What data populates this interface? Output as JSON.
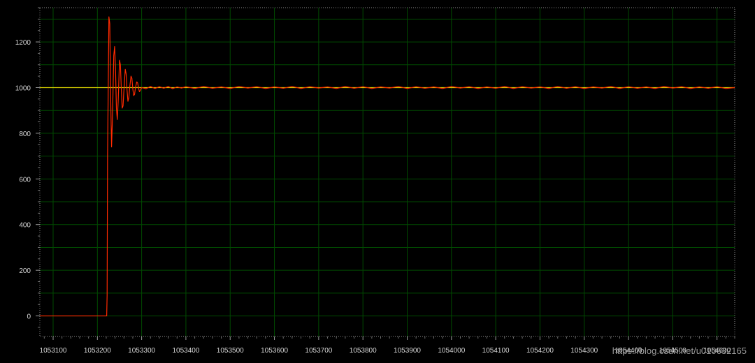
{
  "watermark": "https://blog.csdn.net/u010632165",
  "chart_data": {
    "type": "line",
    "title": "",
    "xlabel": "",
    "ylabel": "",
    "xlim": [
      1053070,
      1054640
    ],
    "ylim": [
      -90,
      1350
    ],
    "grid": true,
    "x_ticks": [
      1053100,
      1053200,
      1053300,
      1053400,
      1053500,
      1053600,
      1053700,
      1053800,
      1053900,
      1054000,
      1054100,
      1054200,
      1054300,
      1054400,
      1054500,
      1054600
    ],
    "x_tick_labels": [
      "1053100",
      "1053200",
      "1053300",
      "1053400",
      "1053500",
      "1053600",
      "1053700",
      "1053800",
      "1053900",
      "1054000",
      "1054100",
      "1054200",
      "1054300",
      "1054400",
      "1054500",
      "1054600"
    ],
    "y_ticks": [
      0,
      200,
      400,
      600,
      800,
      1000,
      1200
    ],
    "y_tick_labels": [
      "0",
      "200",
      "400",
      "600",
      "800",
      "1000",
      "1200"
    ],
    "series": [
      {
        "color": "#d8d000",
        "x": [
          1053070,
          1054640
        ],
        "y": [
          1000,
          1000
        ]
      },
      {
        "color": "#ff2a00",
        "x": [
          1053070,
          1053221,
          1053222,
          1053223,
          1053225,
          1053226,
          1053228,
          1053230,
          1053232,
          1053234,
          1053237,
          1053239,
          1053241,
          1053243,
          1053245,
          1053247,
          1053250,
          1053252,
          1053254,
          1053256,
          1053258,
          1053260,
          1053263,
          1053265,
          1053267,
          1053269,
          1053271,
          1053273,
          1053276,
          1053278,
          1053280,
          1053282,
          1053284,
          1053286,
          1053289,
          1053291,
          1053293,
          1053295,
          1053297,
          1053300,
          1053310,
          1053320,
          1053330,
          1053340,
          1053350,
          1053360,
          1053370,
          1053380,
          1053390,
          1053400,
          1053420,
          1053440,
          1053460,
          1053480,
          1053500,
          1053520,
          1053540,
          1053560,
          1053580,
          1053600,
          1053620,
          1053640,
          1053660,
          1053680,
          1053700,
          1053720,
          1053740,
          1053760,
          1053780,
          1053800,
          1053820,
          1053840,
          1053860,
          1053880,
          1053900,
          1053920,
          1053940,
          1053960,
          1053980,
          1054000,
          1054020,
          1054040,
          1054060,
          1054080,
          1054100,
          1054120,
          1054140,
          1054160,
          1054180,
          1054200,
          1054220,
          1054240,
          1054260,
          1054280,
          1054300,
          1054320,
          1054340,
          1054360,
          1054380,
          1054400,
          1054420,
          1054440,
          1054460,
          1054480,
          1054500,
          1054520,
          1054540,
          1054560,
          1054580,
          1054600,
          1054620,
          1054640
        ],
        "y": [
          0,
          0,
          90,
          700,
          1100,
          1310,
          1280,
          960,
          740,
          860,
          1140,
          1180,
          1080,
          910,
          860,
          940,
          1120,
          1100,
          1000,
          910,
          920,
          990,
          1080,
          1060,
          990,
          940,
          955,
          1000,
          1050,
          1040,
          995,
          965,
          970,
          1000,
          1025,
          1020,
          998,
          982,
          988,
          1000,
          995,
          1005,
          996,
          1004,
          997,
          1005,
          995,
          1003,
          998,
          1004,
          996,
          1005,
          997,
          1003,
          996,
          1005,
          998,
          1004,
          996,
          1003,
          997,
          1005,
          996,
          1004,
          998,
          1003,
          996,
          1005,
          997,
          1004,
          996,
          1003,
          998,
          1005,
          996,
          1004,
          997,
          1003,
          996,
          1005,
          998,
          1004,
          996,
          1003,
          997,
          1005,
          996,
          1004,
          998,
          1003,
          996,
          1005,
          997,
          1004,
          996,
          1003,
          998,
          1005,
          996,
          1004,
          997,
          1003,
          996,
          1005,
          998,
          1004,
          996,
          1003,
          997,
          1004,
          996,
          1000
        ]
      }
    ]
  }
}
